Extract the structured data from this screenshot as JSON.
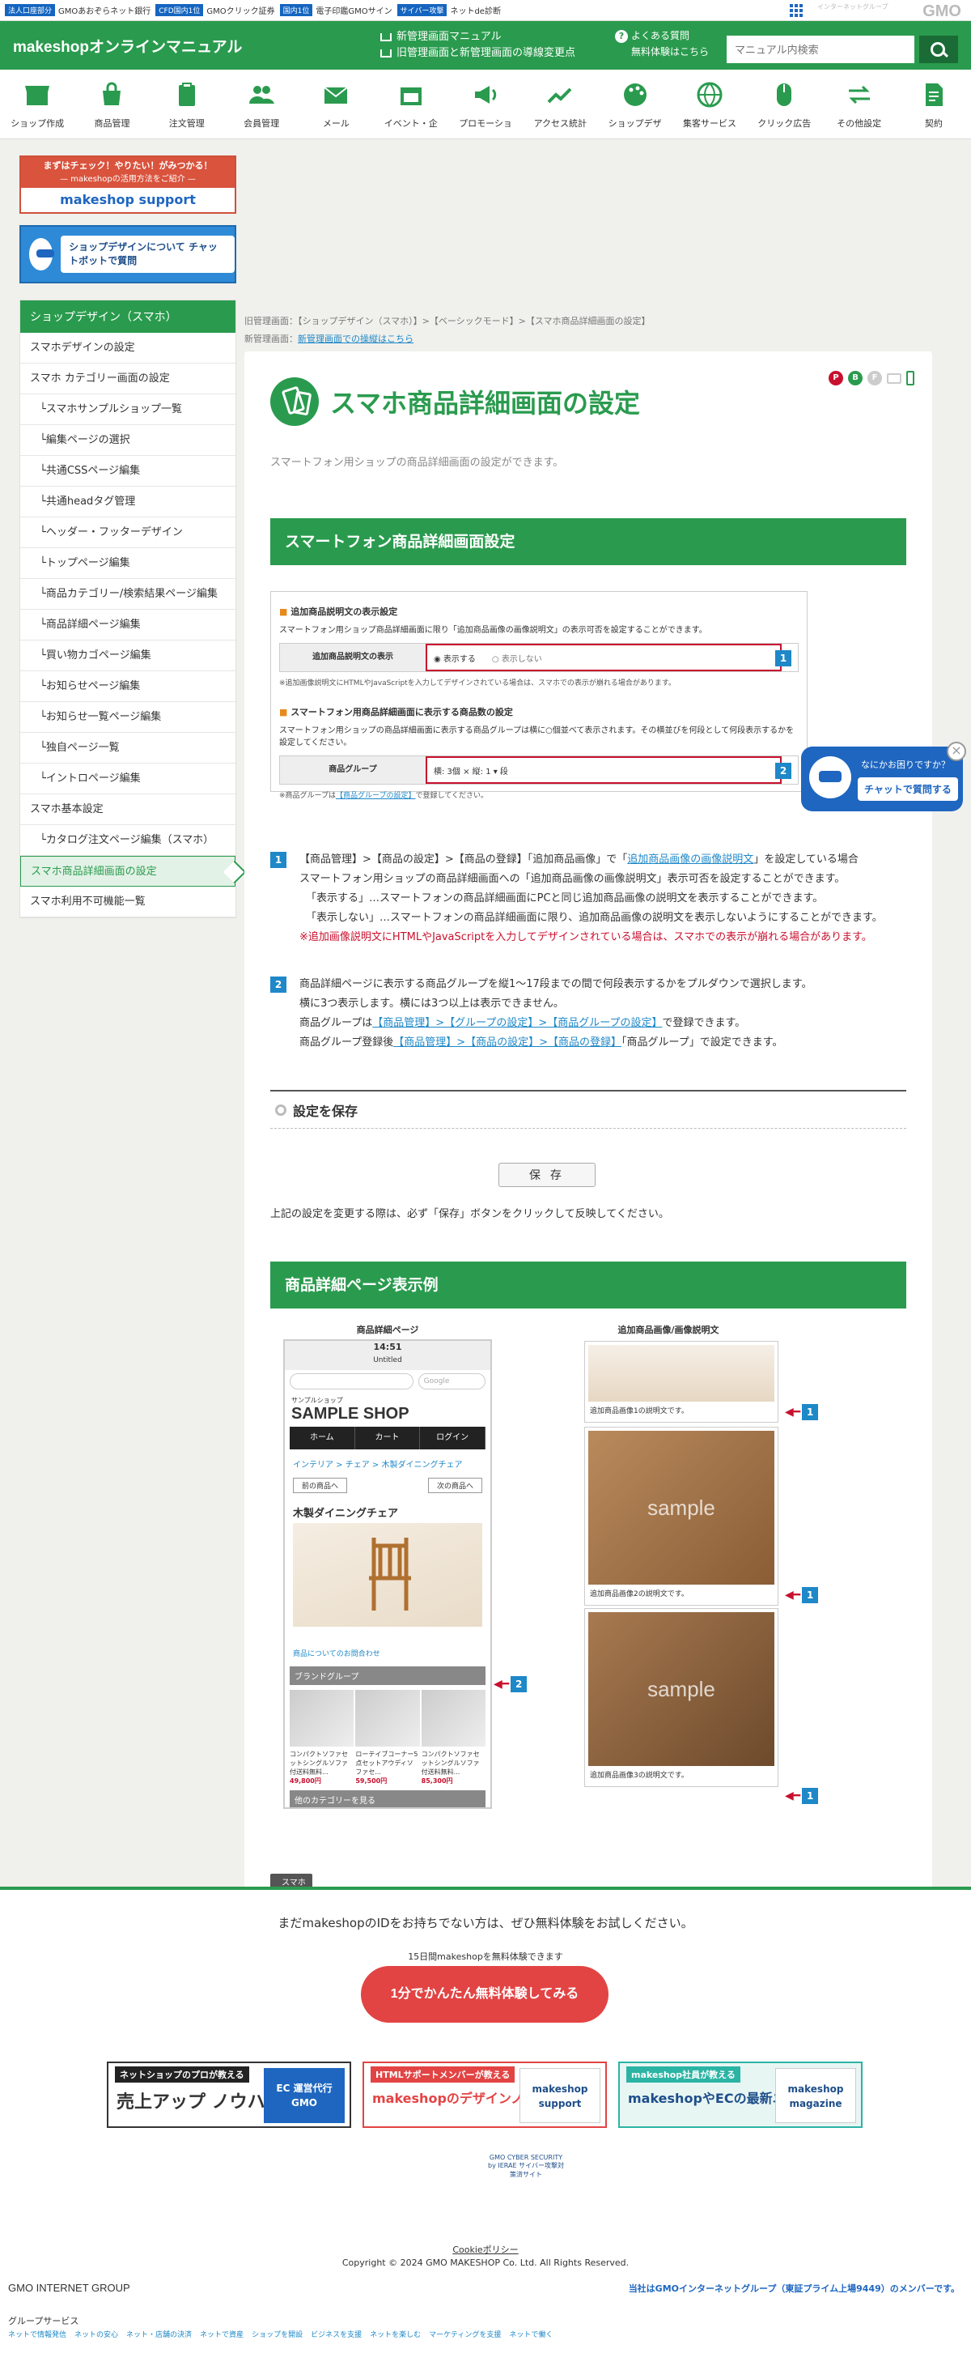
{
  "topbar": {
    "items": [
      {
        "badge": "法人口座部分",
        "text": "GMOあおぞらネット銀行"
      },
      {
        "badge": "CFD国内1位",
        "text": "GMOクリック証券"
      },
      {
        "badge": "国内1位",
        "text": "電子印鑑GMOサイン"
      },
      {
        "badge": "サイバー攻撃",
        "text": "ネットde診断"
      }
    ],
    "gmo_sub": "インターネットグループ",
    "gmo": "GMO"
  },
  "header": {
    "logo": "makeshopオンラインマニュアル",
    "link1": "新管理画面マニュアル",
    "link2": "旧管理画面と新管理画面の導線変更点",
    "faq1": "よくある質問",
    "faq2": "無料体験はこちら",
    "search_placeholder": "マニュアル内検索"
  },
  "gnav": [
    {
      "label": "ショップ作成",
      "icon": "shop-icon"
    },
    {
      "label": "商品管理",
      "icon": "bag-icon"
    },
    {
      "label": "注文管理",
      "icon": "clipboard-icon"
    },
    {
      "label": "会員管理",
      "icon": "users-icon"
    },
    {
      "label": "メール",
      "icon": "mail-icon"
    },
    {
      "label": "イベント・企",
      "icon": "calendar-icon"
    },
    {
      "label": "プロモーショ",
      "icon": "megaphone-icon"
    },
    {
      "label": "アクセス統計",
      "icon": "chart-icon"
    },
    {
      "label": "ショップデザ",
      "icon": "palette-icon"
    },
    {
      "label": "集客サービス",
      "icon": "globe-icon"
    },
    {
      "label": "クリック広告",
      "icon": "mouse-icon"
    },
    {
      "label": "その他設定",
      "icon": "swap-icon"
    },
    {
      "label": "契約",
      "icon": "contract-icon"
    }
  ],
  "banners": {
    "b1a": "まずはチェック！やりたい！がみつかる！",
    "b1b": "— makeshopの活用方法をご紹介 —",
    "b1c": "makeshop support",
    "b2": "ショップデザインについて チャットボットで質問"
  },
  "leftnav": {
    "header": "ショップデザイン（スマホ）",
    "items": [
      {
        "label": "スマホデザインの設定",
        "sub": false
      },
      {
        "label": "スマホ カテゴリー画面の設定",
        "sub": false
      },
      {
        "label": "└スマホサンプルショップ一覧",
        "sub": true
      },
      {
        "label": "└編集ページの選択",
        "sub": true
      },
      {
        "label": "└共通CSSページ編集",
        "sub": true
      },
      {
        "label": "└共通headタグ管理",
        "sub": true
      },
      {
        "label": "└ヘッダー・フッターデザイン",
        "sub": true
      },
      {
        "label": "└トップページ編集",
        "sub": true
      },
      {
        "label": "└商品カテゴリー/検索結果ページ編集",
        "sub": true
      },
      {
        "label": "└商品詳細ページ編集",
        "sub": true
      },
      {
        "label": "└買い物カゴページ編集",
        "sub": true
      },
      {
        "label": "└お知らせページ編集",
        "sub": true
      },
      {
        "label": "└お知らせ一覧ページ編集",
        "sub": true
      },
      {
        "label": "└独自ページ一覧",
        "sub": true
      },
      {
        "label": "└イントロページ編集",
        "sub": true
      },
      {
        "label": "スマホ基本設定",
        "sub": false
      },
      {
        "label": "└カタログ注文ページ編集（スマホ）",
        "sub": true
      },
      {
        "label": "スマホ商品詳細画面の設定",
        "sub": false,
        "active": true
      },
      {
        "label": "スマホ利用不可機能一覧",
        "sub": false
      }
    ]
  },
  "crumb": {
    "old_label": "旧管理画面：",
    "old_path": "【ショップデザイン（スマホ）】>【ベーシックモード】>【スマホ商品詳細画面の設定】",
    "new_label": "新管理画面：",
    "new_link": "新管理画面での操縦はこちら"
  },
  "page": {
    "title": "スマホ商品詳細画面の設定",
    "desc": "スマートフォン用ショップの商品詳細画面の設定ができます。",
    "badges": [
      "P",
      "B",
      "F",
      "",
      ""
    ],
    "section1": "スマートフォン商品詳細画面設定",
    "shot": {
      "h1": "追加商品説明文の表示設定",
      "p1": "スマートフォン用ショップ商品詳細画面に限り「追加商品画像の画像説明文」の表示可否を設定することができます。",
      "row1_label": "追加商品説明文の表示",
      "opt_show": "表示する",
      "opt_hide": "表示しない",
      "note1": "※追加画像説明文にHTMLやJavaScriptを入力してデザインされている場合は、スマホでの表示が崩れる場合があります。",
      "h2": "スマートフォン用商品詳細画面に表示する商品数の設定",
      "p2": "スマートフォン用ショップの商品詳細画面に表示する商品グループは横に○個並べて表示されます。その横並びを何段として何段表示するかを設定してください。",
      "row2_label": "商品グループ",
      "row2_value": "横: 3個 × 縦: 1 ▾ 段",
      "note2_a": "※商品グループは",
      "note2_link": "【商品グループの設定】",
      "note2_b": "で登録してください。"
    },
    "item1": {
      "num": "1",
      "l1a": "【商品管理】>【商品の設定】>【商品の登録】「追加商品画像」で「",
      "l1link": "追加商品画像の画像説明文",
      "l1b": "」を設定している場合",
      "l2": "スマートフォン用ショップの商品詳細画面への「追加商品画像の画像説明文」表示可否を設定することができます。",
      "l3": "「表示する」…スマートフォンの商品詳細画面にPCと同じ追加商品画像の説明文を表示することができます。",
      "l4": "「表示しない」…スマートフォンの商品詳細画面に限り、追加商品画像の説明文を表示しないようにすることができます。",
      "l5": "※追加画像説明文にHTMLやJavaScriptを入力してデザインされている場合は、スマホでの表示が崩れる場合があります。"
    },
    "item2": {
      "num": "2",
      "l1": "商品詳細ページに表示する商品グループを縦1〜17段までの間で何段表示するかをプルダウンで選択します。",
      "l2": "横に3つ表示します。横には3つ以上は表示できません。",
      "l3a": "商品グループは",
      "l3link": "【商品管理】>【グループの設定】>【商品グループの設定】",
      "l3b": "で登録できます。",
      "l4a": "商品グループ登録後",
      "l4link": "【商品管理】>【商品の設定】>【商品の登録】",
      "l4b": "「商品グループ」で設定できます。"
    },
    "save_head": "設定を保存",
    "save_btn": "保 存",
    "save_note": "上記の設定を変更する際は、必ず「保存」ボタンをクリックして反映してください。",
    "section2": "商品詳細ページ表示例",
    "example": {
      "cap_left": "商品詳細ページ",
      "cap_right": "追加商品画像/画像説明文",
      "time": "14:51",
      "untitled": "Untitled",
      "google": "Google",
      "shop_small": "サンプルショップ",
      "shop": "SAMPLE SHOP",
      "tabs": [
        "ホーム",
        "カート",
        "ログイン"
      ],
      "bc": "インテリア > チェア > 木製ダイニングチェア",
      "prev": "前の商品へ",
      "next": "次の商品へ",
      "pname": "木製ダイニングチェア",
      "inquiry": "商品についてのお問合わせ",
      "brand": "ブランドグループ",
      "products": [
        {
          "name": "コンパクトソファセットシングルソファ付送料無料...",
          "price": "49,800円"
        },
        {
          "name": "ローテイブコーナー5点セットアウディソファセ...",
          "price": "59,500円"
        },
        {
          "name": "コンパクトソファセットシングルソファ付送料無料...",
          "price": "85,300円"
        }
      ],
      "other_cat": "他のカテゴリーを見る",
      "photos": [
        {
          "label": "追加商品画像1の説明文です。",
          "sample": ""
        },
        {
          "label": "追加商品画像2の説明文です。",
          "sample": "sample"
        },
        {
          "label": "追加商品画像3の説明文です。",
          "sample": "sample"
        }
      ],
      "marker1": "1",
      "marker2": "2"
    },
    "tag": "スマホ"
  },
  "chatbot": {
    "q": "なにかお困りですか？",
    "c": "チャットで質問する",
    "close": "×"
  },
  "footer": {
    "try": "まだmakeshopのIDをお持ちでない方は、ぜひ無料体験をお試しください。",
    "days": "15日間makeshopを無料体験できます",
    "cta": "1分でかんたん無料体験してみる",
    "b1t1": "ネットショップのプロが教える",
    "b1t2": "売上アップ ノウハウ",
    "b1lg": "EC 運営代行 GMO",
    "b2t1": "HTMLサポートメンバーが教える",
    "b2t2": "makeshopのデザインノウハウ",
    "b2lg": "makeshop support",
    "b3t1": "makeshop社員が教える",
    "b3t2": "makeshopやECの最新ニュース",
    "b3lg": "makeshop magazine",
    "cert": "GMO CYBER SECURITY by IERAE サイバー攻撃対策済サイト",
    "cookie": "Cookieポリシー",
    "copy": "Copyright © 2024 GMO MAKESHOP Co. Ltd. All Rights Reserved.",
    "gmog": "GMO INTERNET GROUP",
    "member": "当社はGMOインターネットグループ（東証プライム上場9449）のメンバーです。",
    "gsl": "グループサービス",
    "gs": [
      "ネットで情報発信",
      "ネットの安心",
      "ネット・店舗の決済",
      "ネットで資産",
      "ショップを開設",
      "ビジネスを支援",
      "ネットを楽しむ",
      "マーケティングを支援",
      "ネットで働く"
    ]
  },
  "colors": {
    "green": "#2a9b4e",
    "blue": "#1e88c8",
    "red": "#c8102e"
  }
}
